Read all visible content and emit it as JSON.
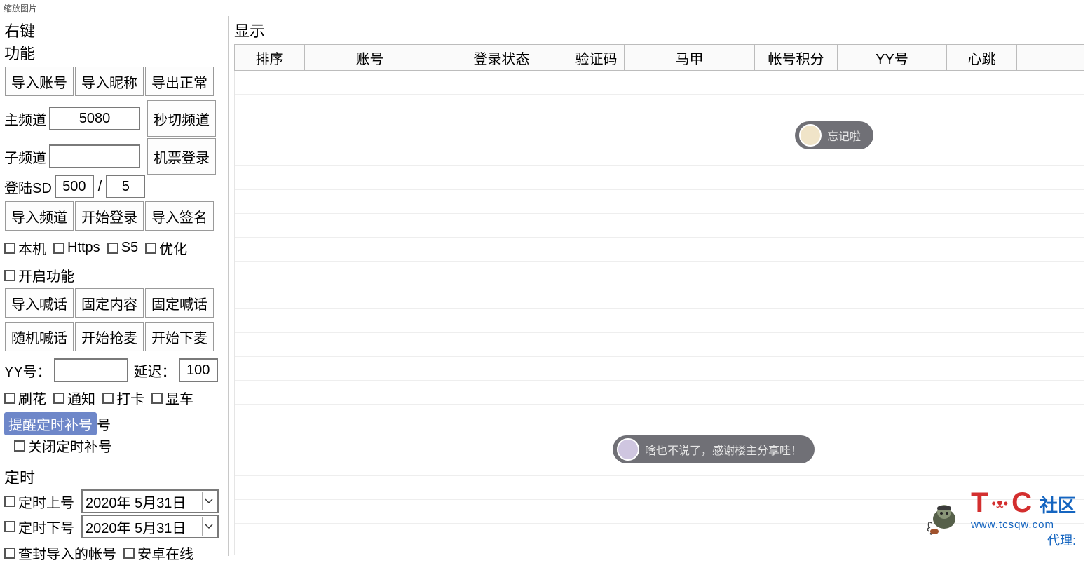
{
  "title": "缩放图片",
  "left": {
    "right_click_group": "右键",
    "function_group": "功能",
    "import_account": "导入账号",
    "import_nickname": "导入昵称",
    "export_normal": "导出正常",
    "main_channel_label": "主频道",
    "main_channel_value": "5080",
    "sub_channel_label": "子频道",
    "sub_channel_value": "",
    "switch_channel": "秒切频道",
    "ticket_login": "机票登录",
    "login_sd_label": "登陆SD",
    "login_sd_value1": "500",
    "login_sd_sep": "/",
    "login_sd_value2": "5",
    "import_channel": "导入频道",
    "start_login": "开始登录",
    "import_signature": "导入签名",
    "chk_local": "本机",
    "chk_https": "Https",
    "chk_s5": "S5",
    "chk_optimize": "优化",
    "enable_function_label": "开启功能",
    "import_shout": "导入喊话",
    "fixed_content": "固定内容",
    "fixed_shout": "固定喊话",
    "random_shout": "随机喊话",
    "start_grab_mic": "开始抢麦",
    "start_drop_mic": "开始下麦",
    "yy_label": "YY号：",
    "yy_value": "",
    "delay_label": "延迟：",
    "delay_value": "100",
    "chk_shuahua": "刷花",
    "chk_notify": "通知",
    "chk_daka": "打卡",
    "chk_xianche": "显车",
    "btn_highlighted": "提醒定时补号",
    "chk_close_timer": "关闭定时补号",
    "timer_group": "定时",
    "chk_timer_on_label": "定时上号",
    "timer_on_date": "2020年 5月31日",
    "chk_timer_off_label": "定时下号",
    "timer_off_date": "2020年 5月31日",
    "chk_check_banned": "查封导入的帐号",
    "chk_android_online": "安卓在线"
  },
  "table": {
    "display_label": "显示",
    "headers": [
      "排序",
      "账号",
      "登录状态",
      "验证码",
      "马甲",
      "帐号积分",
      "YY号",
      "心跳"
    ]
  },
  "bubbles": {
    "b1": "忘记啦",
    "b2": "啥也不说了，感谢楼主分享哇！"
  },
  "logo": {
    "t": "T",
    "c": "C",
    "paw": "•ᴥ•",
    "cn": "社区",
    "url": "www.tcsqw.com",
    "daili": "代理:"
  }
}
